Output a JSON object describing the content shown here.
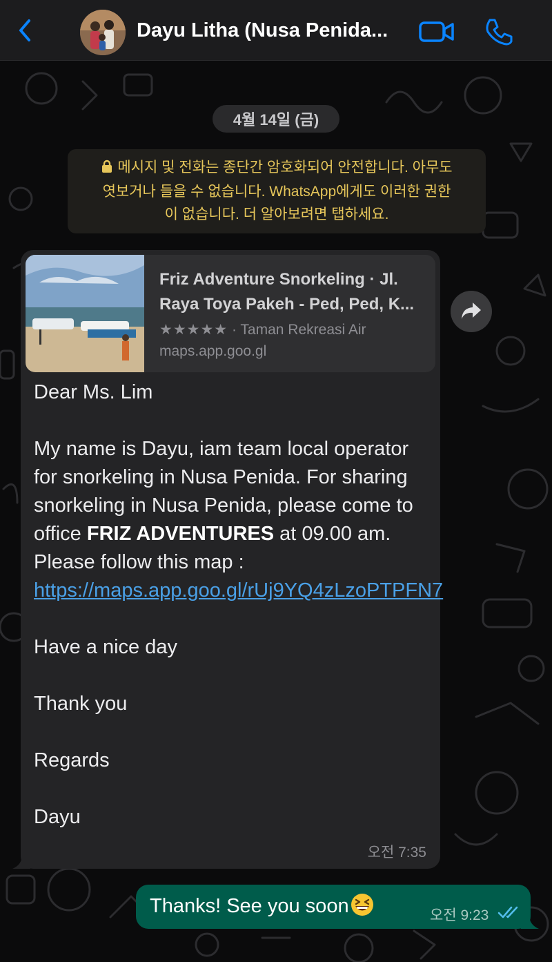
{
  "header": {
    "title": "Dayu Litha (Nusa Penida...",
    "back_icon": "chevron-left-icon",
    "video_icon": "video-camera-icon",
    "call_icon": "phone-icon",
    "accent": "#0a84ff"
  },
  "date_pill": "4월 14일 (금)",
  "notice": {
    "line1": "메시지 및 전화는 종단간 암호화되어 안전합니다. 아무도",
    "line2": "엿보거나 들을 수 없습니다. WhatsApp에게도 이러한 권한",
    "line3": "이 없습니다. 더 알아보려면 탭하세요.",
    "color": "#e6c65a"
  },
  "incoming": {
    "preview": {
      "title_line1": "Friz Adventure Snorkeling · Jl.",
      "title_line2": "Raya Toya Pakeh - Ped, Ped, K...",
      "stars": "★★★★★",
      "category": "· Taman Rekreasi Air",
      "domain": "maps.app.goo.gl"
    },
    "greeting": "Dear Ms. Lim",
    "para_a": "My name is Dayu, iam team local operator for snorkeling in Nusa Penida. For sharing snorkeling in Nusa Penida, please come to office ",
    "bold": "FRIZ ADVENTURES",
    "para_b": " at 09.00 am. Please follow this map : ",
    "link": "https://maps.app.goo.gl/rUj9YQ4zLzoPTPFN7",
    "line_nice": "Have a nice day",
    "line_thanks": "Thank you",
    "line_regards": "Regards",
    "line_sign": "Dayu",
    "time": "오전 7:35"
  },
  "outgoing": {
    "text": "Thanks! See you soon",
    "emoji": "grinning-squinting-face",
    "time": "오전 9:23",
    "status_icon": "double-check-read-icon",
    "bubble_color": "#005c4b"
  }
}
